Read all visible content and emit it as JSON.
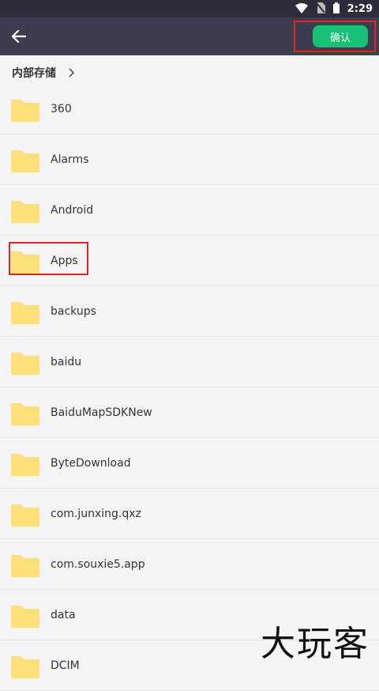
{
  "statusbar": {
    "time": "2:29"
  },
  "toolbar": {
    "confirm_label": "确认"
  },
  "breadcrumb": {
    "label": "内部存储"
  },
  "folders": [
    "360",
    "Alarms",
    "Android",
    "Apps",
    "backups",
    "baidu",
    "BaiduMapSDKNew",
    "ByteDownload",
    "com.junxing.qxz",
    "com.souxie5.app",
    "data",
    "DCIM"
  ],
  "watermark": {
    "text": "大玩客"
  },
  "colors": {
    "statusbar": "#2c2c3a",
    "toolbar": "#3d3d4f",
    "confirm": "#17c278",
    "folder": "#ffe07a",
    "highlight": "#e02424"
  }
}
